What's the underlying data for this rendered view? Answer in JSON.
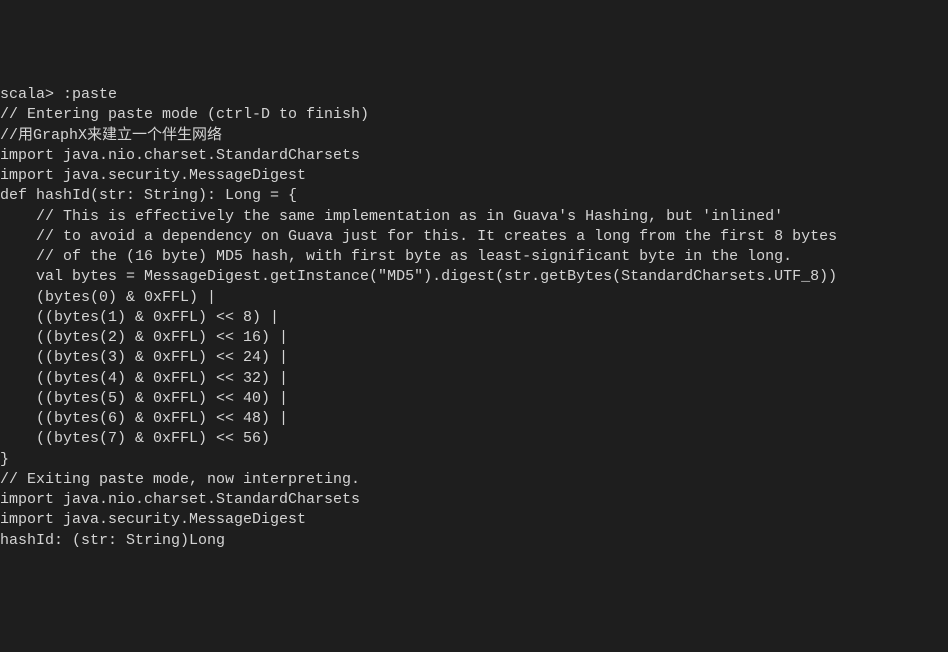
{
  "terminal": {
    "lines": [
      "scala> :paste",
      "// Entering paste mode (ctrl-D to finish)",
      "",
      "//用GraphX来建立一个伴生网络",
      "import java.nio.charset.StandardCharsets",
      "import java.security.MessageDigest",
      "def hashId(str: String): Long = {",
      "    // This is effectively the same implementation as in Guava's Hashing, but 'inlined'",
      "    // to avoid a dependency on Guava just for this. It creates a long from the first 8 bytes",
      "    // of the (16 byte) MD5 hash, with first byte as least-significant byte in the long.",
      "    val bytes = MessageDigest.getInstance(\"MD5\").digest(str.getBytes(StandardCharsets.UTF_8))",
      "    (bytes(0) & 0xFFL) |",
      "    ((bytes(1) & 0xFFL) << 8) |",
      "    ((bytes(2) & 0xFFL) << 16) |",
      "    ((bytes(3) & 0xFFL) << 24) |",
      "    ((bytes(4) & 0xFFL) << 32) |",
      "    ((bytes(5) & 0xFFL) << 40) |",
      "    ((bytes(6) & 0xFFL) << 48) |",
      "    ((bytes(7) & 0xFFL) << 56)",
      "}",
      "",
      "// Exiting paste mode, now interpreting.",
      "",
      "import java.nio.charset.StandardCharsets",
      "import java.security.MessageDigest",
      "hashId: (str: String)Long"
    ]
  }
}
